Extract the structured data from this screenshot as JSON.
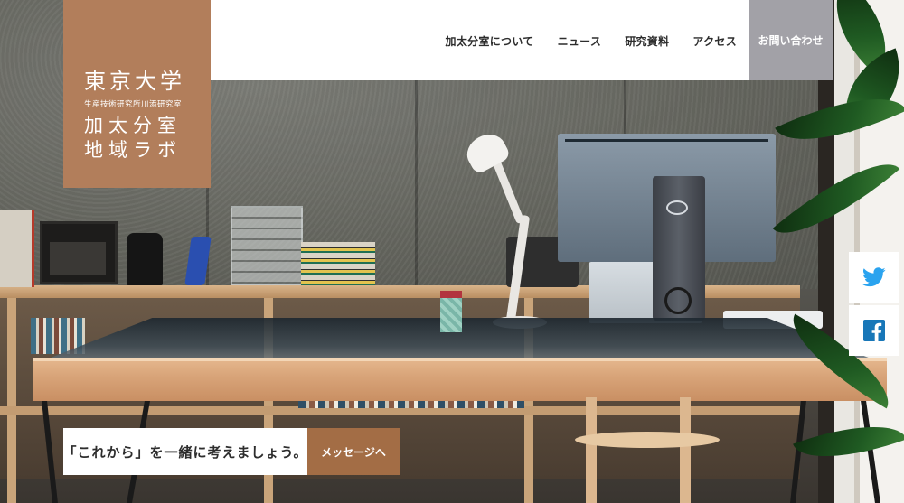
{
  "logo": {
    "line1": "東京大学",
    "line2": "生産技術研究所川添研究室",
    "line3": "加太分室",
    "line4": "地域ラボ"
  },
  "nav": {
    "items": [
      {
        "label": "加太分室について"
      },
      {
        "label": "ニュース"
      },
      {
        "label": "研究資料"
      },
      {
        "label": "アクセス"
      }
    ],
    "contact_label": "お問い合わせ"
  },
  "social": {
    "twitter_icon": "twitter-icon",
    "facebook_icon": "facebook-icon"
  },
  "message": {
    "text": "「これから」を一緒に考えましょう。",
    "button_label": "メッセージへ"
  },
  "colors": {
    "logo_bg": "#b27e5b",
    "contact_bg": "#a2a1a7",
    "message_button_bg": "#a36d45",
    "twitter_blue": "#2aa3ef",
    "facebook_blue": "#1877b8"
  }
}
